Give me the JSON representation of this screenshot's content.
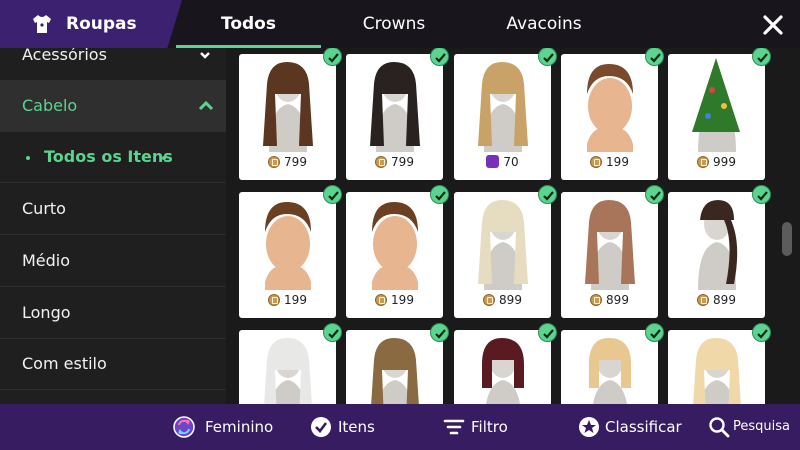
{
  "header": {
    "title": "Roupas",
    "tabs": [
      {
        "label": "Todos",
        "active": true
      },
      {
        "label": "Crowns",
        "active": false
      },
      {
        "label": "Avacoins",
        "active": false
      }
    ]
  },
  "sidebar": {
    "items": [
      {
        "label": "Acessórios"
      },
      {
        "label": "Cabelo"
      },
      {
        "label": "Todos os Itens"
      },
      {
        "label": "Curto"
      },
      {
        "label": "Médio"
      },
      {
        "label": "Longo"
      },
      {
        "label": "Com estilo"
      }
    ]
  },
  "grid": {
    "items": [
      {
        "price": "799",
        "currency": "coin",
        "owned": true,
        "hair": "brown-long"
      },
      {
        "price": "799",
        "currency": "coin",
        "owned": true,
        "hair": "black-long"
      },
      {
        "price": "70",
        "currency": "gem",
        "owned": true,
        "hair": "blonde-wavy"
      },
      {
        "price": "199",
        "currency": "coin",
        "owned": true,
        "hair": "brown-short"
      },
      {
        "price": "999",
        "currency": "coin",
        "owned": true,
        "hair": "christmas-tree"
      },
      {
        "price": "199",
        "currency": "coin",
        "owned": true,
        "hair": "brown-bun"
      },
      {
        "price": "199",
        "currency": "coin",
        "owned": true,
        "hair": "brown-bun"
      },
      {
        "price": "899",
        "currency": "coin",
        "owned": true,
        "hair": "platinum-long"
      },
      {
        "price": "899",
        "currency": "coin",
        "owned": true,
        "hair": "light-brown-wavy"
      },
      {
        "price": "899",
        "currency": "coin",
        "owned": true,
        "hair": "dark-braid"
      },
      {
        "price": "",
        "currency": "coin",
        "owned": true,
        "hair": "white-long"
      },
      {
        "price": "",
        "currency": "coin",
        "owned": true,
        "hair": "ombre-wavy"
      },
      {
        "price": "",
        "currency": "coin",
        "owned": true,
        "hair": "red-bob"
      },
      {
        "price": "",
        "currency": "coin",
        "owned": true,
        "hair": "blonde-bangs"
      },
      {
        "price": "",
        "currency": "coin",
        "owned": true,
        "hair": "blonde-long"
      }
    ]
  },
  "bottom": {
    "feminino": "Feminino",
    "itens": "Itens",
    "filtro": "Filtro",
    "classificar": "Classificar",
    "pesquisa": "Pesquisa"
  },
  "colors": {
    "accent": "#5ad48e",
    "brand": "#3b2170",
    "bottombar": "#371c62"
  },
  "icons": {
    "brand": "shirt-icon",
    "close": "close-icon",
    "feminino": "gender-swap-icon",
    "itens": "check-circle-icon",
    "filtro": "filter-lines-icon",
    "classificar": "star-badge-icon",
    "pesquisa": "search-icon"
  }
}
